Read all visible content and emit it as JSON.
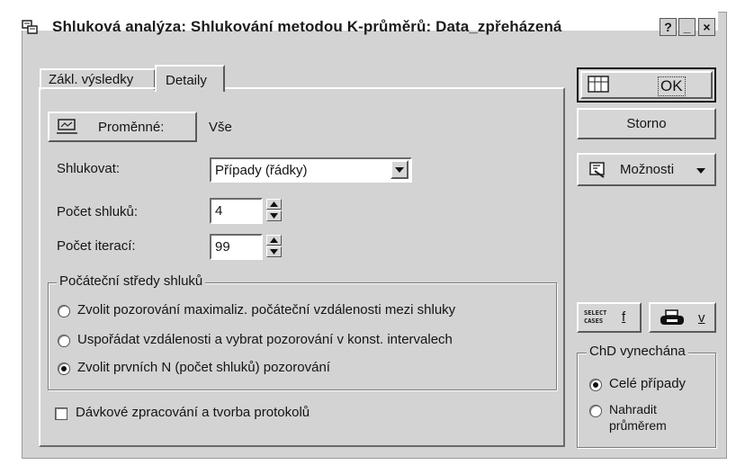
{
  "window": {
    "title": "Shluková analýza: Shlukování metodou K-průměrů: Data_zpřeházená",
    "help_label": "?",
    "minimize_label": "_",
    "close_label": "×"
  },
  "tabs": [
    {
      "label": "Zákl. výsledky"
    },
    {
      "label": "Detaily"
    }
  ],
  "variables": {
    "button_label": "Proměnné:",
    "value": "Vše"
  },
  "cluster": {
    "label": "Shlukovat:",
    "selected": "Případy (řádky)",
    "num_clusters_label": "Počet shluků:",
    "num_clusters_value": "4",
    "iterations_label": "Počet iterací:",
    "iterations_value": "99"
  },
  "initial_centers": {
    "legend": "Počáteční středy shluků",
    "options": [
      {
        "label": "Zvolit pozorování maximaliz. počáteční vzdálenosti mezi shluky"
      },
      {
        "label": "Uspořádat vzdálenosti a vybrat pozorování v konst. intervalech"
      },
      {
        "label": "Zvolit prvních N (počet shluků) pozorování"
      }
    ],
    "selected_index": 2
  },
  "batch": {
    "label": "Dávkové zpracování a tvorba protokolů",
    "checked": false
  },
  "side": {
    "ok_label": "OK",
    "cancel_label": "Storno",
    "options_label": "Možnosti",
    "select_cases_line1": "SELECT",
    "select_cases_line2": "CASES",
    "select_cases_key": "f",
    "print_key": "v"
  },
  "missing": {
    "legend": "ChD vynechána",
    "option1": "Celé případy",
    "option2_line1": "Nahradit",
    "option2_line2": "průměrem",
    "selected_index": 0
  },
  "colors": {
    "face": "#d3d3d3",
    "shadow": "#6a6a6a",
    "highlight": "#ffffff"
  },
  "icons": [
    "window-icon",
    "variables-icon",
    "dropdown-arrow-icon",
    "spin-up-icon",
    "spin-down-icon",
    "options-icon",
    "printer-icon",
    "ok-icon"
  ]
}
